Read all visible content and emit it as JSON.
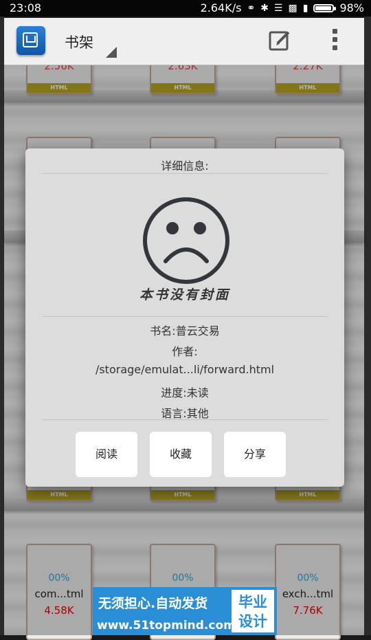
{
  "status_bar": {
    "time": "23:08",
    "speed": "2.64K/s",
    "battery": "98%",
    "icons": [
      "headphones-icon",
      "bluetooth-icon",
      "wifi-icon",
      "signal-4g-icon",
      "signal-icon",
      "battery-icon"
    ]
  },
  "app_bar": {
    "title": "书架",
    "icons": [
      "app-logo-icon",
      "edit-icon",
      "more-vert-icon"
    ]
  },
  "shelf": {
    "row_top": [
      {
        "size": "2.56K",
        "band": "HTML"
      },
      {
        "size": "2.63K",
        "band": "HTML"
      },
      {
        "size": "2.27K",
        "band": "HTML"
      }
    ],
    "row_mid_band": "HTML",
    "row_bottom": [
      {
        "progress": "00%",
        "name": "com...tml",
        "size": "4.58K"
      },
      {
        "progress": "00%",
        "name": "",
        "size": ""
      },
      {
        "progress": "00%",
        "name": "exch...tml",
        "size": "7.76K"
      }
    ]
  },
  "dialog": {
    "heading": "详细信息:",
    "no_cover_text": "本书没有封面",
    "book_name": "书名:普云交易",
    "author": "作者:",
    "path": "/storage/emulat...li/forward.html",
    "progress": "进度:未读",
    "language": "语言:其他",
    "buttons": {
      "read": "阅读",
      "favorite": "收藏",
      "share": "分享"
    }
  },
  "banner": {
    "line1": "无须担心.自动发货",
    "line2": "www.51topmind.com",
    "box": "毕业设计"
  },
  "colors": {
    "band": "#b4a423",
    "size_text": "#e53b3b",
    "progress_text": "#2aa6d8",
    "banner": "#2a8ed6"
  }
}
